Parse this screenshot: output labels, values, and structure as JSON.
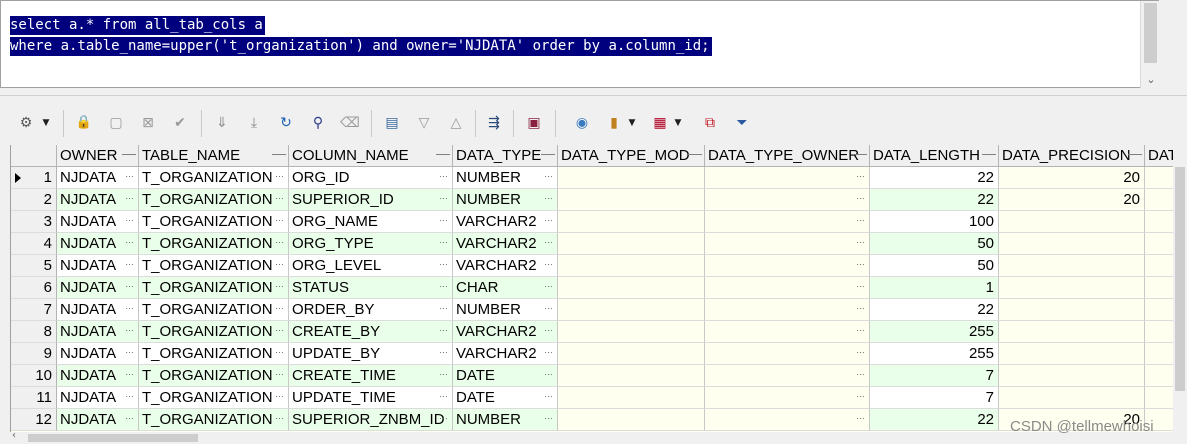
{
  "editor": {
    "lines": [
      "select a.* from all_tab_cols a",
      "where a.table_name=upper('t_organization') and owner='NJDATA' order by a.column_id;"
    ]
  },
  "toolbar": {
    "buttons": [
      {
        "icon": "grid-settings-icon",
        "glyph": "⚙"
      },
      {
        "icon": "lock-icon",
        "glyph": "🔒"
      },
      {
        "icon": "insert-record-icon",
        "glyph": "▢"
      },
      {
        "icon": "delete-record-icon",
        "glyph": "⊠"
      },
      {
        "icon": "post-changes-icon",
        "glyph": "✔"
      },
      {
        "icon": "next-page-icon",
        "glyph": "⇓"
      },
      {
        "icon": "last-page-icon",
        "glyph": "⤓"
      },
      {
        "icon": "refresh-icon",
        "glyph": "↻"
      },
      {
        "icon": "find-icon",
        "glyph": "⚲"
      },
      {
        "icon": "clear-icon",
        "glyph": "⌫"
      },
      {
        "icon": "query-by-example-icon",
        "glyph": "▤"
      },
      {
        "icon": "sort-down-icon",
        "glyph": "▽"
      },
      {
        "icon": "sort-up-icon",
        "glyph": "△"
      },
      {
        "icon": "connect-icon",
        "glyph": "⇶"
      },
      {
        "icon": "save-icon",
        "glyph": "▣"
      },
      {
        "icon": "export-icon",
        "glyph": "◉"
      },
      {
        "icon": "chart-icon",
        "glyph": "▮"
      },
      {
        "icon": "table-view-icon",
        "glyph": "▦"
      },
      {
        "icon": "compare-icon",
        "glyph": "⧉"
      },
      {
        "icon": "filter-icon",
        "glyph": "⏷"
      }
    ]
  },
  "grid": {
    "columns": [
      "OWNER",
      "TABLE_NAME",
      "COLUMN_NAME",
      "DATA_TYPE",
      "DATA_TYPE_MOD",
      "DATA_TYPE_OWNER",
      "DATA_LENGTH",
      "DATA_PRECISION",
      "DAT"
    ],
    "rows": [
      {
        "rn": "1",
        "owner": "NJDATA",
        "table_name": "T_ORGANIZATION",
        "column_name": "ORG_ID",
        "data_type": "NUMBER",
        "data_type_mod": "",
        "data_type_owner": "",
        "data_length": "22",
        "data_precision": "20"
      },
      {
        "rn": "2",
        "owner": "NJDATA",
        "table_name": "T_ORGANIZATION",
        "column_name": "SUPERIOR_ID",
        "data_type": "NUMBER",
        "data_type_mod": "",
        "data_type_owner": "",
        "data_length": "22",
        "data_precision": "20"
      },
      {
        "rn": "3",
        "owner": "NJDATA",
        "table_name": "T_ORGANIZATION",
        "column_name": "ORG_NAME",
        "data_type": "VARCHAR2",
        "data_type_mod": "",
        "data_type_owner": "",
        "data_length": "100",
        "data_precision": ""
      },
      {
        "rn": "4",
        "owner": "NJDATA",
        "table_name": "T_ORGANIZATION",
        "column_name": "ORG_TYPE",
        "data_type": "VARCHAR2",
        "data_type_mod": "",
        "data_type_owner": "",
        "data_length": "50",
        "data_precision": ""
      },
      {
        "rn": "5",
        "owner": "NJDATA",
        "table_name": "T_ORGANIZATION",
        "column_name": "ORG_LEVEL",
        "data_type": "VARCHAR2",
        "data_type_mod": "",
        "data_type_owner": "",
        "data_length": "50",
        "data_precision": ""
      },
      {
        "rn": "6",
        "owner": "NJDATA",
        "table_name": "T_ORGANIZATION",
        "column_name": "STATUS",
        "data_type": "CHAR",
        "data_type_mod": "",
        "data_type_owner": "",
        "data_length": "1",
        "data_precision": ""
      },
      {
        "rn": "7",
        "owner": "NJDATA",
        "table_name": "T_ORGANIZATION",
        "column_name": "ORDER_BY",
        "data_type": "NUMBER",
        "data_type_mod": "",
        "data_type_owner": "",
        "data_length": "22",
        "data_precision": ""
      },
      {
        "rn": "8",
        "owner": "NJDATA",
        "table_name": "T_ORGANIZATION",
        "column_name": "CREATE_BY",
        "data_type": "VARCHAR2",
        "data_type_mod": "",
        "data_type_owner": "",
        "data_length": "255",
        "data_precision": ""
      },
      {
        "rn": "9",
        "owner": "NJDATA",
        "table_name": "T_ORGANIZATION",
        "column_name": "UPDATE_BY",
        "data_type": "VARCHAR2",
        "data_type_mod": "",
        "data_type_owner": "",
        "data_length": "255",
        "data_precision": ""
      },
      {
        "rn": "10",
        "owner": "NJDATA",
        "table_name": "T_ORGANIZATION",
        "column_name": "CREATE_TIME",
        "data_type": "DATE",
        "data_type_mod": "",
        "data_type_owner": "",
        "data_length": "7",
        "data_precision": ""
      },
      {
        "rn": "11",
        "owner": "NJDATA",
        "table_name": "T_ORGANIZATION",
        "column_name": "UPDATE_TIME",
        "data_type": "DATE",
        "data_type_mod": "",
        "data_type_owner": "",
        "data_length": "7",
        "data_precision": ""
      },
      {
        "rn": "12",
        "owner": "NJDATA",
        "table_name": "T_ORGANIZATION",
        "column_name": "SUPERIOR_ZNBM_ID",
        "data_type": "NUMBER",
        "data_type_mod": "",
        "data_type_owner": "",
        "data_length": "22",
        "data_precision": "20"
      }
    ]
  },
  "watermark": "CSDN @tellmewhoisi",
  "colors": {
    "selection": "#00007f",
    "row_alt": "#eaffea",
    "readonly_cell": "#fffff0"
  }
}
